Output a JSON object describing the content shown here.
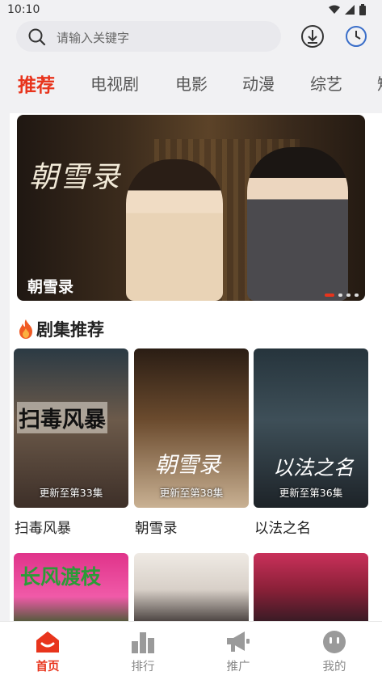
{
  "status_bar": {
    "time": "10:10",
    "icons": [
      "wifi-icon",
      "signal-icon",
      "battery-icon"
    ]
  },
  "search": {
    "placeholder": "请输入关键字",
    "icon": "search-icon"
  },
  "header_actions": [
    "download-icon",
    "history-clock-icon"
  ],
  "tabs": [
    {
      "label": "推荐",
      "active": true
    },
    {
      "label": "电视剧",
      "active": false
    },
    {
      "label": "电影",
      "active": false
    },
    {
      "label": "动漫",
      "active": false
    },
    {
      "label": "综艺",
      "active": false
    },
    {
      "label": "短",
      "active": false
    }
  ],
  "banner": {
    "title": "朝雪录",
    "calligraphy": "朝雪录",
    "page_count": 4,
    "active_index": 0
  },
  "section": {
    "title": "剧集推荐",
    "icon": "fire-icon"
  },
  "dramas": [
    {
      "poster_text": "扫毒风暴",
      "update": "更新至第33集",
      "name": "扫毒风暴"
    },
    {
      "poster_text": "朝雪录",
      "update": "更新至第38集",
      "name": "朝雪录"
    },
    {
      "poster_text": "以法之名",
      "update": "更新至第36集",
      "name": "以法之名"
    }
  ],
  "dramas_row2": [
    {
      "poster_text": "长风渡枝"
    },
    {
      "poster_text": ""
    },
    {
      "poster_text": ""
    }
  ],
  "bottom_nav": [
    {
      "label": "首页",
      "icon": "home-icon",
      "active": true
    },
    {
      "label": "排行",
      "icon": "ranking-icon",
      "active": false
    },
    {
      "label": "推广",
      "icon": "megaphone-icon",
      "active": false
    },
    {
      "label": "我的",
      "icon": "profile-face-icon",
      "active": false
    }
  ],
  "colors": {
    "accent": "#e8341c",
    "background": "#f1f1f3",
    "text": "#222222"
  }
}
